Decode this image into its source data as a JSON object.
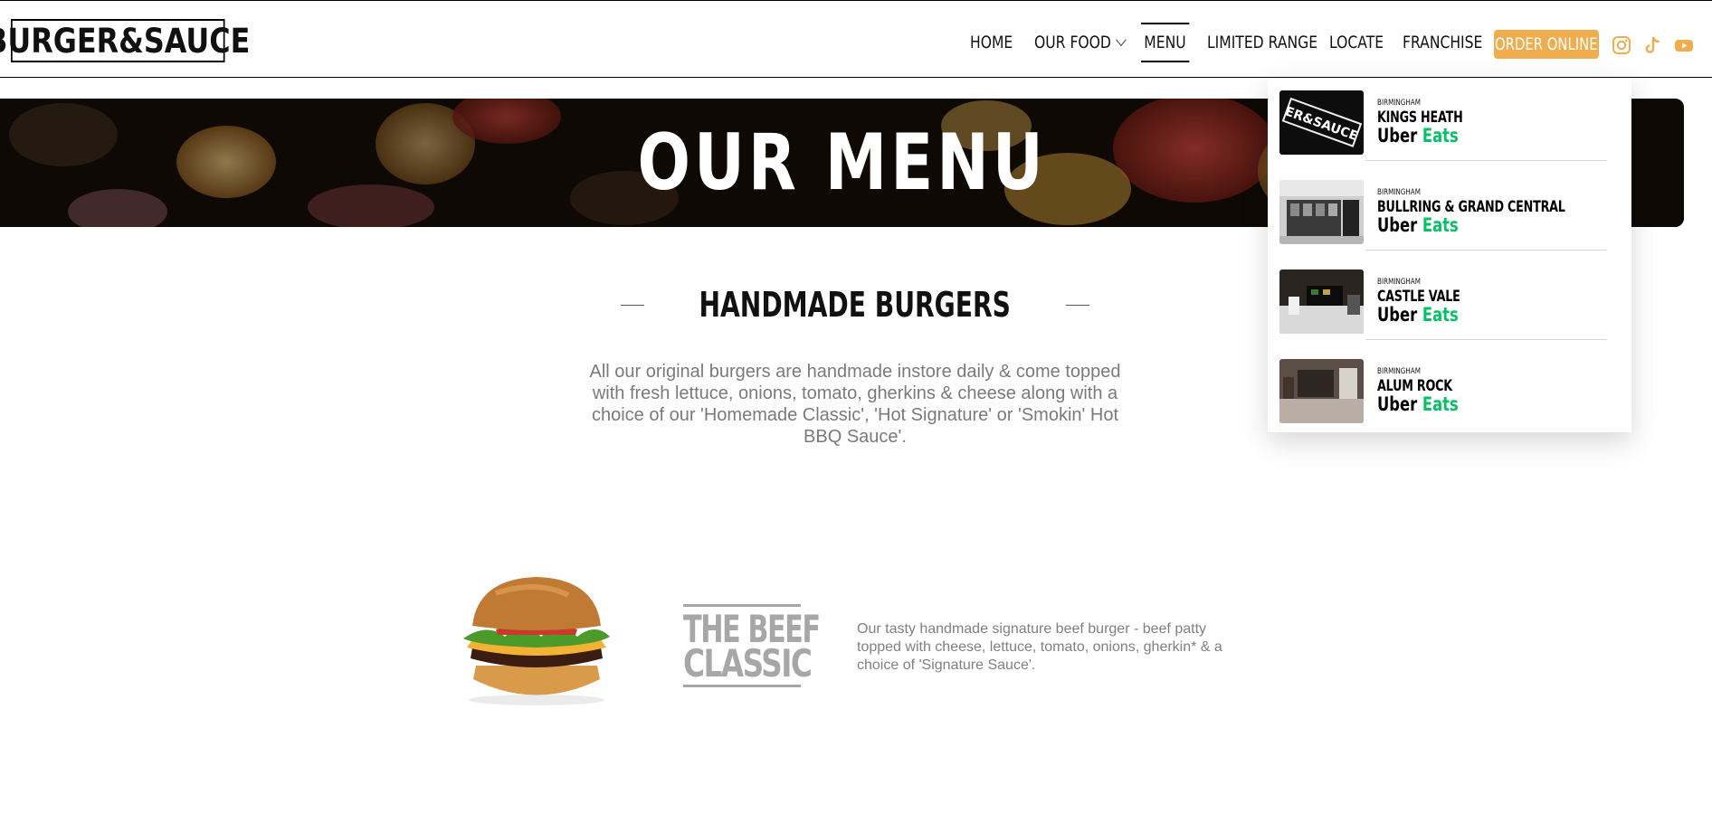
{
  "header": {
    "logo_text": "BURGER&SAUCE",
    "nav": [
      {
        "label": "HOME",
        "active": false
      },
      {
        "label": "OUR FOOD",
        "active": false,
        "has_dropdown": true
      },
      {
        "label": "MENU",
        "active": true
      },
      {
        "label": "LIMITED RANGE",
        "active": false
      },
      {
        "label": "LOCATE",
        "active": false
      },
      {
        "label": "FRANCHISE",
        "active": false
      }
    ],
    "order_button": "ORDER ONLINE",
    "social_icons": [
      "instagram-icon",
      "tiktok-icon",
      "youtube-icon"
    ],
    "accent_color": "#f0ad4e"
  },
  "hero": {
    "title": "OUR MENU"
  },
  "section": {
    "title": "HANDMADE BURGERS",
    "description": "All our original burgers are handmade instore daily & come topped with fresh lettuce, onions, tomato, gherkins & cheese along with a choice of our 'Homemade Classic', 'Hot Signature' or 'Smokin' Hot BBQ Sauce'."
  },
  "product": {
    "name_line1": "THE BEEF",
    "name_line2": "CLASSIC",
    "description": "Our tasty handmade signature beef burger - beef patty topped with cheese, lettuce, tomato, onions, gherkin* & a choice of 'Signature Sauce'."
  },
  "dropdown": {
    "uber_label": "Uber",
    "eats_label": "Eats",
    "eats_color": "#06c167",
    "locations": [
      {
        "city": "BIRMINGHAM",
        "name": "KINGS HEATH"
      },
      {
        "city": "BIRMINGHAM",
        "name": "BULLRING & GRAND CENTRAL"
      },
      {
        "city": "BIRMINGHAM",
        "name": "CASTLE VALE"
      },
      {
        "city": "BIRMINGHAM",
        "name": "ALUM ROCK"
      }
    ]
  }
}
